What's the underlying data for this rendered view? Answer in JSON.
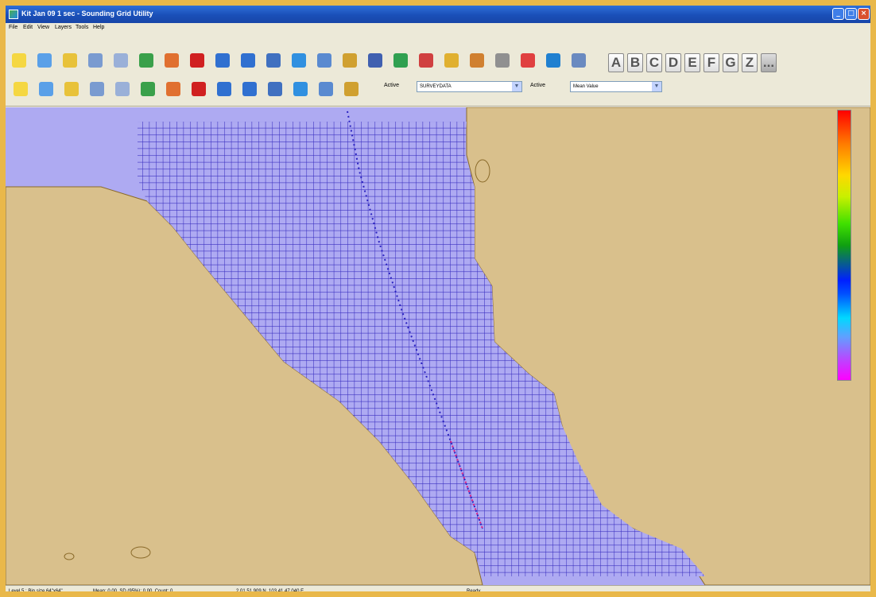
{
  "window": {
    "title": "Kit Jan 09 1 sec - Sounding Grid Utility",
    "buttons": {
      "minimize": "_",
      "maximize": "□",
      "close": "×"
    }
  },
  "menu": [
    "File",
    "Edit",
    "View",
    "Layers",
    "Tools",
    "Help"
  ],
  "toolbar": {
    "letters": [
      "A",
      "B",
      "C",
      "D",
      "E",
      "F",
      "G",
      "Z",
      "..."
    ],
    "active_label_1": "Active",
    "active_layer": "SURVEYDATA",
    "active_label_2": "Active",
    "active_value": "Mean Value",
    "icons_row1": [
      "new-icon",
      "open-icon",
      "layers-icon",
      "print-icon",
      "page-icon",
      "download-green-icon",
      "download-red-icon",
      "delete-icon",
      "pan-icon",
      "pan-icon-2",
      "export-icon",
      "refresh-icon",
      "select-icon",
      "zoom-icon",
      "satellite-icon",
      "zoom-in-icon",
      "zoom-out-icon",
      "zoom-extent-icon",
      "zoom-select-icon",
      "zoom-prev-icon",
      "info-icon",
      "globe-icon",
      "pointer-icon"
    ],
    "icons_row2": [
      "sigma-icon",
      "bar-chart-icon",
      "area-chart-icon",
      "line-tool-icon",
      "node-tool-icon",
      "measure-icon",
      "shape-icon",
      "polygon-icon",
      "surface-icon",
      "contour-icon",
      "grid-icon",
      "color-ramp-icon",
      "render-icon",
      "histogram-icon"
    ]
  },
  "legend": {
    "colors": [
      "#ff0000",
      "#ffd800",
      "#40e000",
      "#0020ff",
      "#00d8ff",
      "#ff00ff"
    ]
  },
  "status": {
    "level": "Level 5 : Bin size 64\"x64\"",
    "stats": "Mean: 0.00, SD (95%): 0.00, Count: 0",
    "coords": "2,01,51.909 N, 103,41,47.040 E",
    "state": "Ready"
  }
}
